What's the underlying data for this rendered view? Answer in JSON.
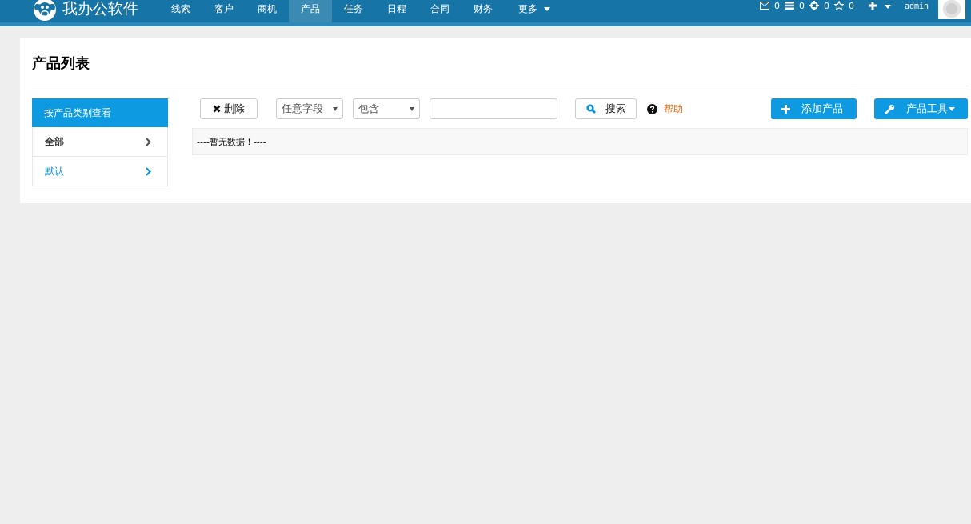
{
  "brand": {
    "name": "我办公软件"
  },
  "nav": [
    {
      "label": "线索",
      "selected": false,
      "kind": "link"
    },
    {
      "label": "客户",
      "selected": false,
      "kind": "link"
    },
    {
      "label": "商机",
      "selected": false,
      "kind": "link"
    },
    {
      "label": "产品",
      "selected": true,
      "kind": "link"
    },
    {
      "label": "任务",
      "selected": false,
      "kind": "link"
    },
    {
      "label": "日程",
      "selected": false,
      "kind": "link"
    },
    {
      "label": "合同",
      "selected": false,
      "kind": "link"
    },
    {
      "label": "财务",
      "selected": false,
      "kind": "link"
    },
    {
      "label": "更多",
      "selected": false,
      "kind": "dropdown"
    }
  ],
  "counters": [
    {
      "kind": "mail",
      "count": "0"
    },
    {
      "kind": "list",
      "count": "0"
    },
    {
      "kind": "target",
      "count": "0"
    },
    {
      "kind": "star",
      "count": "0"
    }
  ],
  "user": {
    "name": "admin"
  },
  "page": {
    "title": "产品列表"
  },
  "sidebar": {
    "header": "按产品类别查看",
    "items": [
      {
        "label": "全部",
        "selected": true
      },
      {
        "label": "默认",
        "selected": false
      }
    ]
  },
  "toolbar": {
    "delete_button": "删除",
    "field_select": "任意字段",
    "condition_select": "包含",
    "search_button": "搜索",
    "help_link": "帮助",
    "add_button": "添加产品",
    "tools_button": "产品工具"
  },
  "table": {
    "empty_message": "----暂无数据！----"
  }
}
